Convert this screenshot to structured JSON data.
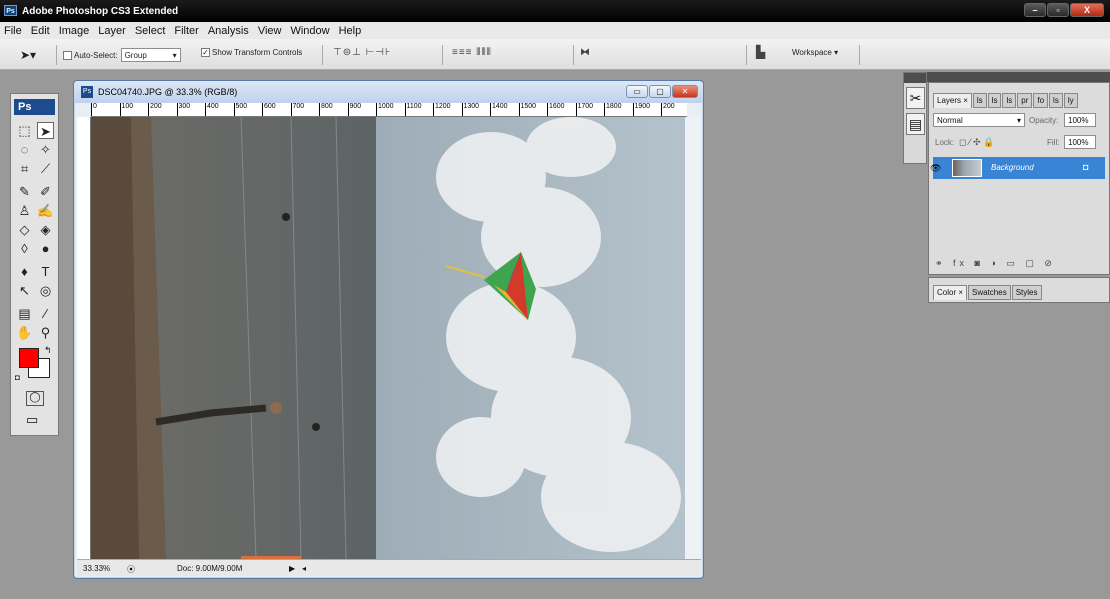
{
  "titlebar": {
    "title": "Adobe Photoshop CS3 Extended",
    "logo": "Ps",
    "buttons": [
      "–",
      "▫",
      "X"
    ]
  },
  "menu": [
    "File",
    "Edit",
    "Image",
    "Layer",
    "Select",
    "Filter",
    "Analysis",
    "View",
    "Window",
    "Help"
  ],
  "options": {
    "auto_select_label": "Auto-Select:",
    "auto_select_value": "Group",
    "show_transform_label": "Show Transform Controls",
    "workspace_label": "Workspace ▾"
  },
  "tools": {
    "header": "Ps",
    "fg_color": "#ff0000",
    "bg_color": "#ffffff"
  },
  "document": {
    "title": "DSC04740.JPG @ 33.3% (RGB/8)",
    "zoom": "33.33%",
    "doc_size": "Doc: 9.00M/9.00M",
    "ruler_ticks": [
      "0",
      "100",
      "200",
      "300",
      "400",
      "500",
      "600",
      "700",
      "800",
      "900",
      "1000",
      "1100",
      "1200",
      "1300",
      "1400",
      "1500",
      "1600",
      "1700",
      "1800",
      "1900",
      "200"
    ]
  },
  "layers_panel": {
    "tabs": [
      "Layers ×",
      "ls",
      "ls",
      "ls",
      "pr",
      "fo",
      "ls",
      "ly"
    ],
    "blend_mode": "Normal",
    "opacity_label": "Opacity:",
    "opacity_value": "100%",
    "lock_label": "Lock:",
    "fill_label": "Fill:",
    "fill_value": "100%",
    "layer_name": "Background"
  },
  "color_panel": {
    "tabs": [
      "Color ×",
      "Swatches",
      "Styles"
    ]
  }
}
